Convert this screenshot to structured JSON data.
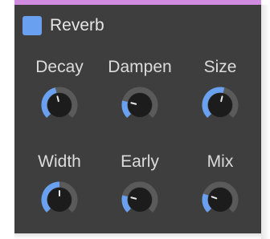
{
  "plugin": {
    "title": "Reverb",
    "enabled": true,
    "colors": {
      "header_bar": "#d18be0",
      "panel": "#3e3e3e",
      "accent": "#6aa0f0",
      "knob_body": "#1c1c1c",
      "knob_track": "#5a5a5a",
      "label": "#dcdcdc"
    }
  },
  "knobs": [
    {
      "label": "Decay",
      "value": 0.45
    },
    {
      "label": "Dampen",
      "value": 0.22
    },
    {
      "label": "Size",
      "value": 0.55
    },
    {
      "label": "Width",
      "value": 0.5
    },
    {
      "label": "Early",
      "value": 0.22
    },
    {
      "label": "Mix",
      "value": 0.24
    }
  ]
}
